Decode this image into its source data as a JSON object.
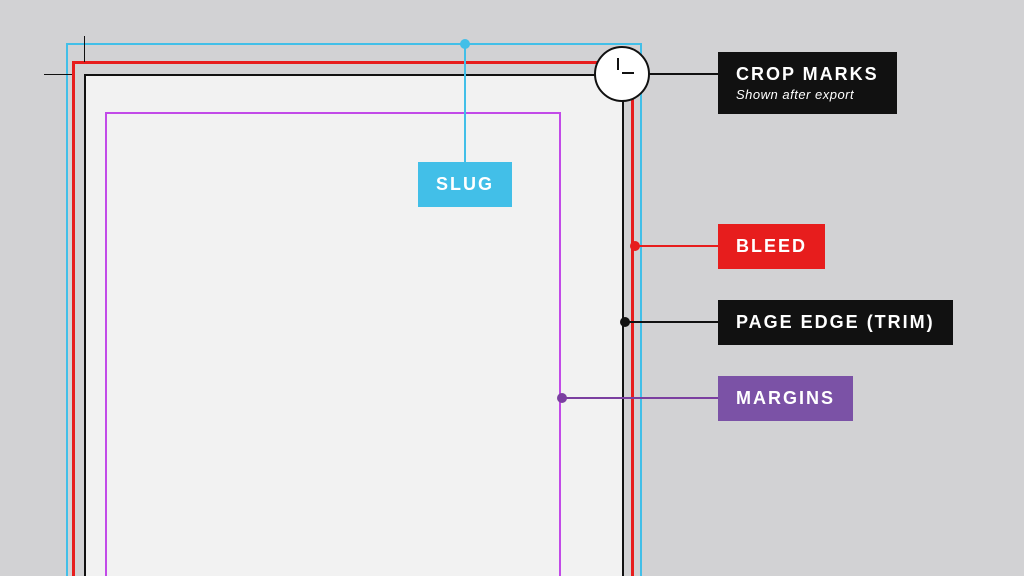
{
  "labels": {
    "slug": "SLUG",
    "crop_marks": "CROP MARKS",
    "crop_marks_sub": "Shown after export",
    "bleed": "BLEED",
    "page_edge": "PAGE EDGE (TRIM)",
    "margins": "MARGINS"
  },
  "colors": {
    "slug_line": "#42bfe8",
    "slug_label_bg": "#42bfe8",
    "bleed_line": "#e71d1d",
    "bleed_label_bg": "#e71d1d",
    "page_edge_line": "#111111",
    "page_edge_label_bg": "#111111",
    "margins_line": "#c24ae8",
    "margins_label_bg": "#7b52a6",
    "crop_label_bg": "#111111",
    "paper_bg": "#f2f2f2"
  },
  "geometry_note": "Diagram of print-layout terminology: outermost light-blue border = slug area; red border inside it = bleed; white/grey rectangle with black edge = actual page (trim); magenta border inside page = margins; crop marks appear at the trim corner after export."
}
